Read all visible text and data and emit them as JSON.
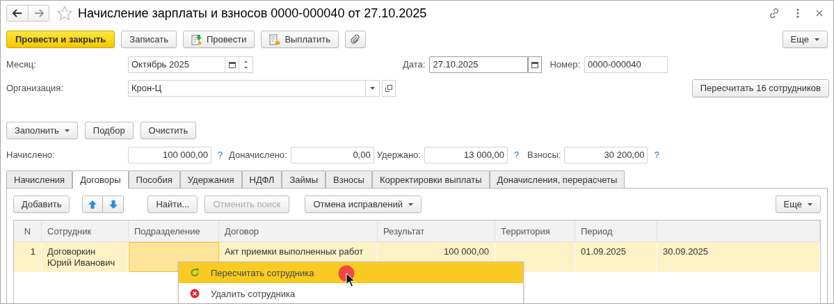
{
  "window": {
    "title": "Начисление зарплаты и взносов 0000-000040 от 27.10.2025"
  },
  "toolbar": [
    {
      "label": "Провести и закрыть",
      "kind": "default"
    },
    {
      "label": "Записать",
      "kind": "plain"
    },
    {
      "label": "Провести",
      "kind": "post"
    },
    {
      "label": "Выплатить",
      "kind": "pay"
    },
    {
      "kind": "attach"
    }
  ],
  "more_button": "Еще",
  "month": {
    "label": "Месяц:",
    "value": "Октябрь 2025"
  },
  "date": {
    "label": "Дата:",
    "value": "27.10.2025"
  },
  "number": {
    "label": "Номер:",
    "value": "0000-000040"
  },
  "organization": {
    "label": "Организация:",
    "value": "Крон-Ц"
  },
  "recalc_button": "Пересчитать 16 сотрудников",
  "fill_buttons": [
    {
      "label": "Заполнить",
      "dropdown": true
    },
    {
      "label": "Подбор",
      "dropdown": false
    },
    {
      "label": "Очистить",
      "dropdown": false
    }
  ],
  "totals": [
    {
      "label": "Начислено:",
      "value": "100 000,00",
      "help": "?"
    },
    {
      "label": "Доначислено:",
      "value": "0,00"
    },
    {
      "label": "Удержано:",
      "value": "13 000,00",
      "help": "?"
    },
    {
      "label": "Взносы:",
      "value": "30 200,00",
      "help": "?"
    }
  ],
  "tabs": [
    {
      "label": "Начисления",
      "selected": false
    },
    {
      "label": "Договоры",
      "selected": true
    },
    {
      "label": "Пособия",
      "selected": false
    },
    {
      "label": "Удержания",
      "selected": false
    },
    {
      "label": "НДФЛ",
      "selected": false
    },
    {
      "label": "Займы",
      "selected": false
    },
    {
      "label": "Взносы",
      "selected": false
    },
    {
      "label": "Корректировки выплаты",
      "selected": false
    },
    {
      "label": "Доначисления, перерасчеты",
      "selected": false
    }
  ],
  "table_toolbar": {
    "add": "Добавить",
    "find": "Найти...",
    "cancel_search": {
      "label": "Отменить поиск",
      "disabled": true
    },
    "undo": "Отмена исправлений",
    "more": "Еще"
  },
  "table": {
    "columns": [
      {
        "label": "N",
        "current": false
      },
      {
        "label": "Сотрудник",
        "current": false
      },
      {
        "label": "Подразделение",
        "current": true
      },
      {
        "label": "Договор",
        "current": false
      },
      {
        "label": "Результат",
        "current": false
      },
      {
        "label": "Территория",
        "current": false
      },
      {
        "label": "Период",
        "current": false
      }
    ],
    "rows": [
      {
        "n": "1",
        "employee": "Договоркин Юрий Иванович",
        "contract": "Акт приемки выполненных работ",
        "result": "100 000,00",
        "period_start": "01.09.2025",
        "period_end": "30.09.2025",
        "selected": true
      }
    ]
  },
  "context_menu": [
    {
      "label": "Пересчитать сотрудника",
      "kind": "recalc",
      "selected": true
    },
    {
      "label": "Удалить сотрудника",
      "kind": "delete",
      "selected": false
    }
  ]
}
